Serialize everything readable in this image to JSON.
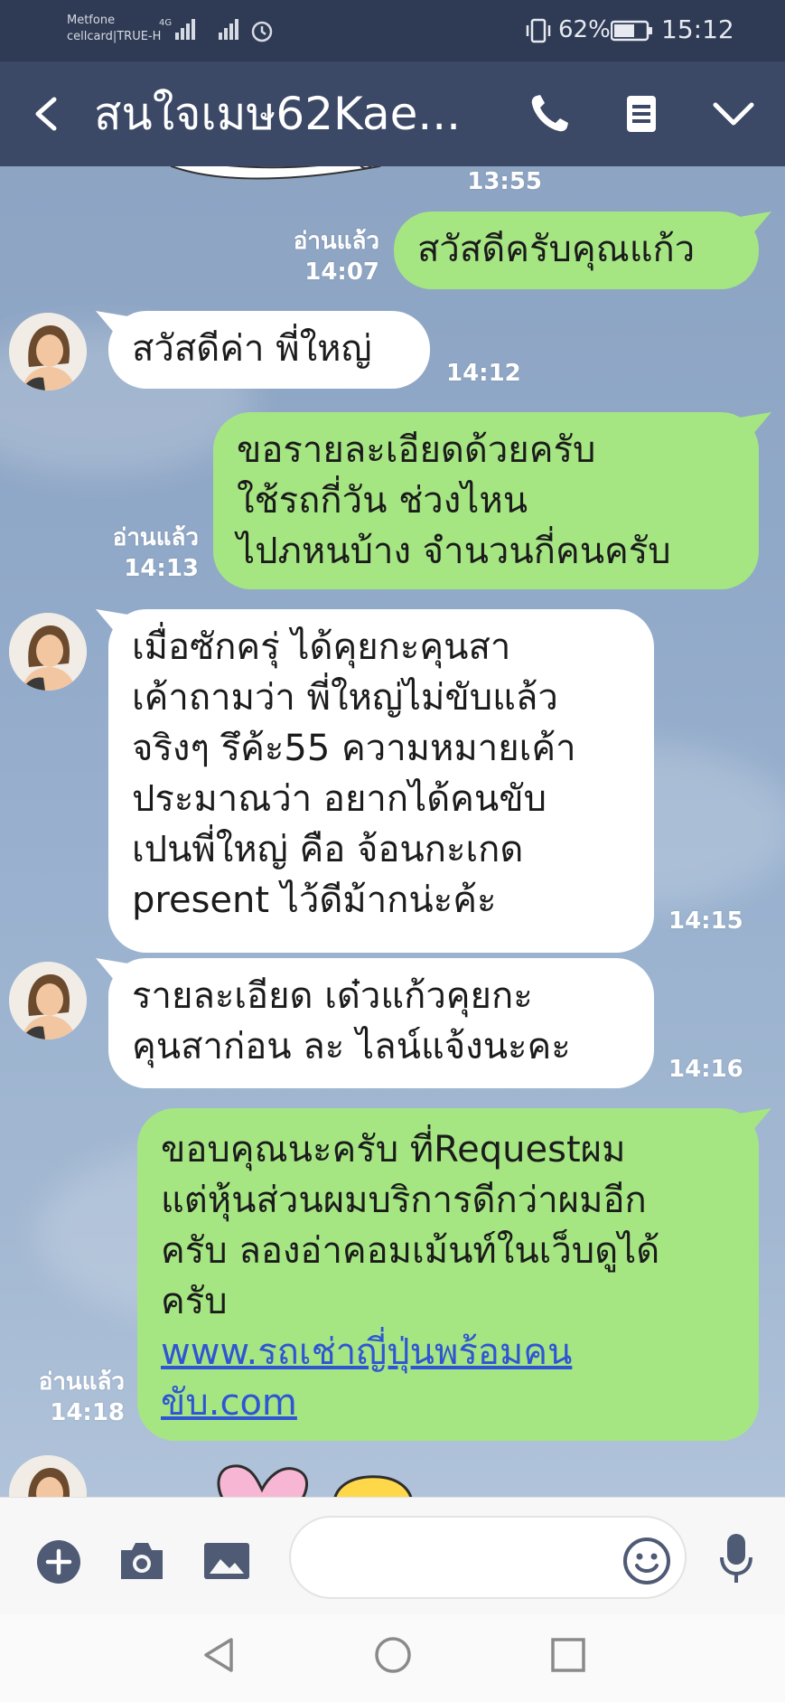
{
  "status_bar": {
    "carrier_line1": "Metfone",
    "carrier_line2": "cellcard|TRUE-H",
    "network": "4G",
    "battery": "62%",
    "time": "15:12"
  },
  "header": {
    "title": "สนใจเมษ62Kae...",
    "icons": [
      "back-arrow-icon",
      "phone-icon",
      "notes-icon",
      "chevron-down-icon"
    ]
  },
  "messages": [
    {
      "id": "m0",
      "direction": "meta",
      "time": "13:55"
    },
    {
      "id": "m1",
      "direction": "out",
      "lines": [
        "สวัสดีครับคุณแก้ว"
      ],
      "read": "อ่านแล้ว",
      "time": "14:07"
    },
    {
      "id": "m2",
      "direction": "in",
      "lines": [
        "สวัสดีค่า พี่ใหญ่"
      ],
      "time": "14:12"
    },
    {
      "id": "m3",
      "direction": "out",
      "lines": [
        "ขอรายละเอียดด้วยครับ",
        "ใช้รถกี่วัน ช่วงไหน",
        "ไปภหนบ้าง จำนวนกี่คนครับ"
      ],
      "read": "อ่านแล้ว",
      "time": "14:13"
    },
    {
      "id": "m4",
      "direction": "in",
      "lines": [
        "เมื่อซักครุ่ ได้คุยกะคุนสา",
        "เค้าถามว่า พี่ใหญ่ไม่ขับแล้ว",
        "จริงๆ รึค้ะ55 ความหมายเค้า",
        "ประมาณว่า อยากได้คนขับ",
        "เปนพี่ใหญ่ คือ จ้อนกะเกด",
        "present ไว้ดีม้ากน่ะค้ะ"
      ],
      "time": "14:15"
    },
    {
      "id": "m5",
      "direction": "in",
      "lines": [
        "รายละเอียด เด๋วแก้วคุยกะ",
        "คุนสาก่อน ละ ไลน์แจ้งนะคะ"
      ],
      "time": "14:16"
    },
    {
      "id": "m6",
      "direction": "out",
      "lines": [
        "ขอบคุณนะครับ ที่Requestผม",
        "แต่หุ้นส่วนผมบริการดีกว่าผมอีก",
        "ครับ ลองอ่าคอมเม้นท์ในเว็บดูได้",
        "ครับ"
      ],
      "link_lines": [
        "www.รถเช่าญี่ปุ่นพร้อมคน",
        "ขับ.com"
      ],
      "read": "อ่านแล้ว",
      "time": "14:18"
    }
  ],
  "input_bar": {
    "placeholder": "",
    "icons": [
      "plus-icon",
      "camera-icon",
      "image-icon",
      "emoji-icon",
      "microphone-icon"
    ]
  },
  "nav_bar": {
    "icons": [
      "nav-back-icon",
      "nav-home-icon",
      "nav-recent-icon"
    ]
  },
  "colors": {
    "status_bg": "#2f3a54",
    "header_bg": "#3b4866",
    "chat_bg": "#91a9c8",
    "bubble_out": "#a5e683",
    "bubble_in": "#ffffff",
    "link": "#2f55d4"
  }
}
